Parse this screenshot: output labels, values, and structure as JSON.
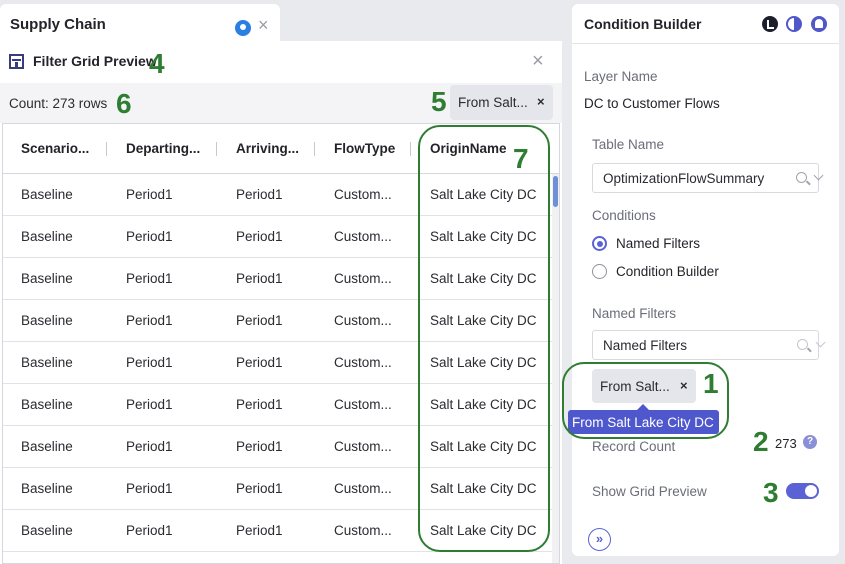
{
  "window_tab": {
    "title": "Supply Chain"
  },
  "filter_grid_preview": {
    "title": "Filter Grid Preview",
    "count_text": "Count: 273 rows",
    "active_filter_chip": "From Salt...",
    "chip_remove": "×",
    "columns": [
      "Scenario...",
      "Departing...",
      "Arriving...",
      "FlowType",
      "OriginName"
    ],
    "rows": [
      [
        "Baseline",
        "Period1",
        "Period1",
        "Custom...",
        "Salt Lake City DC"
      ],
      [
        "Baseline",
        "Period1",
        "Period1",
        "Custom...",
        "Salt Lake City DC"
      ],
      [
        "Baseline",
        "Period1",
        "Period1",
        "Custom...",
        "Salt Lake City DC"
      ],
      [
        "Baseline",
        "Period1",
        "Period1",
        "Custom...",
        "Salt Lake City DC"
      ],
      [
        "Baseline",
        "Period1",
        "Period1",
        "Custom...",
        "Salt Lake City DC"
      ],
      [
        "Baseline",
        "Period1",
        "Period1",
        "Custom...",
        "Salt Lake City DC"
      ],
      [
        "Baseline",
        "Period1",
        "Period1",
        "Custom...",
        "Salt Lake City DC"
      ],
      [
        "Baseline",
        "Period1",
        "Period1",
        "Custom...",
        "Salt Lake City DC"
      ],
      [
        "Baseline",
        "Period1",
        "Period1",
        "Custom...",
        "Salt Lake City DC"
      ]
    ]
  },
  "condition_builder": {
    "title": "Condition Builder",
    "layer_name_label": "Layer Name",
    "layer_name_value": "DC to Customer Flows",
    "table_name_label": "Table Name",
    "table_name_value": "OptimizationFlowSummary",
    "conditions_label": "Conditions",
    "condition_options": [
      {
        "label": "Named Filters",
        "selected": true
      },
      {
        "label": "Condition Builder",
        "selected": false
      }
    ],
    "named_filters_label": "Named Filters",
    "named_filters_placeholder": "Named Filters",
    "selected_filter_chip": "From Salt...",
    "chip_remove": "×",
    "tooltip": "From Salt Lake City DC",
    "record_count_label": "Record Count",
    "record_count_value": "273",
    "help_glyph": "?",
    "show_grid_preview_label": "Show Grid Preview",
    "show_grid_preview_on": true,
    "expand_glyph": "»"
  },
  "annotations": [
    "1",
    "2",
    "3",
    "4",
    "5",
    "6",
    "7"
  ],
  "colors": {
    "accent": "#5b62d6",
    "annotation": "#2e7d32",
    "tooltip_bg": "#4f57cd"
  }
}
